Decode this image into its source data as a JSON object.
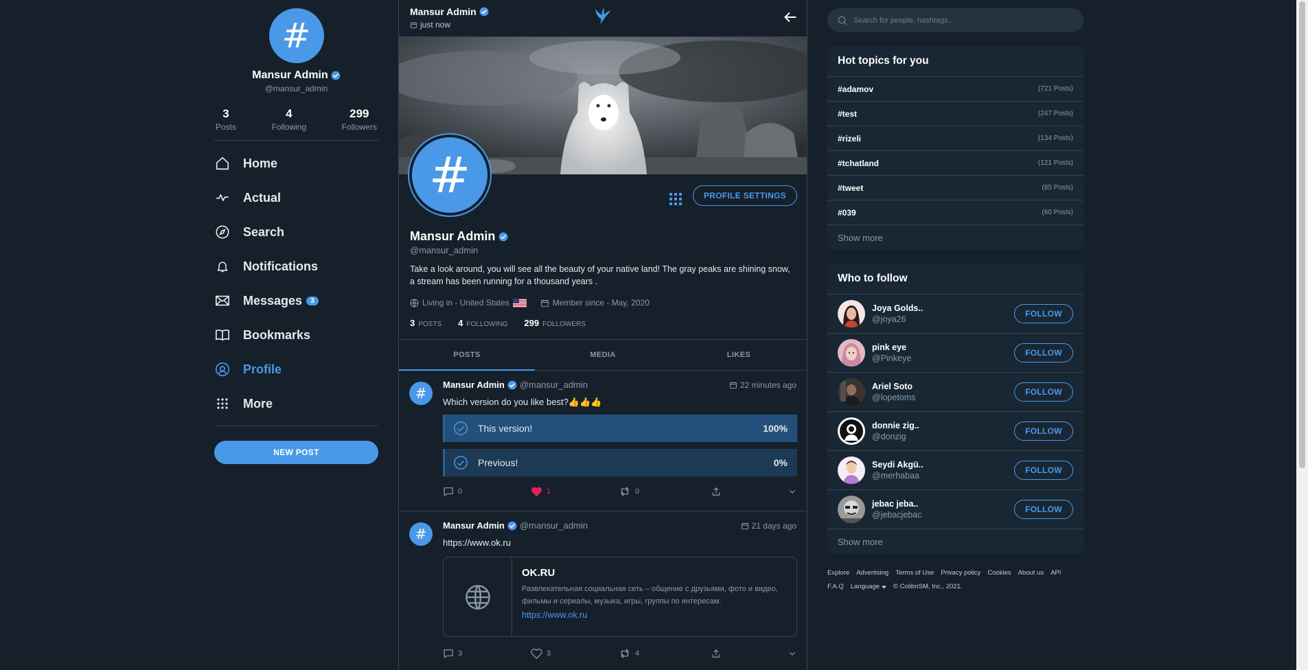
{
  "sidebar": {
    "profile": {
      "name": "Mansur Admin",
      "handle": "@mansur_admin"
    },
    "stats": [
      {
        "value": "3",
        "label": "Posts"
      },
      {
        "value": "4",
        "label": "Following"
      },
      {
        "value": "299",
        "label": "Followers"
      }
    ],
    "nav": [
      {
        "label": "Home",
        "icon": "home-icon"
      },
      {
        "label": "Actual",
        "icon": "activity-icon"
      },
      {
        "label": "Search",
        "icon": "compass-icon"
      },
      {
        "label": "Notifications",
        "icon": "bell-icon"
      },
      {
        "label": "Messages",
        "icon": "mail-icon",
        "badge": "3"
      },
      {
        "label": "Bookmarks",
        "icon": "book-icon"
      },
      {
        "label": "Profile",
        "icon": "at-icon",
        "active": true
      },
      {
        "label": "More",
        "icon": "grid-icon"
      }
    ],
    "new_post_label": "NEW POST"
  },
  "topbar": {
    "name": "Mansur Admin",
    "time": "just now"
  },
  "profile": {
    "name": "Mansur Admin",
    "handle": "@mansur_admin",
    "settings_label": "PROFILE SETTINGS",
    "bio": "Take a look around, you will see all the beauty of your native land! The gray peaks are shining snow, a stream has been running for a thousand years .",
    "location": "Living in - United States",
    "member_since": "Member since - May, 2020",
    "counts": [
      {
        "value": "3",
        "label": "POSTS"
      },
      {
        "value": "4",
        "label": "FOLLOWING"
      },
      {
        "value": "299",
        "label": "FOLLOWERS"
      }
    ]
  },
  "tabs": [
    {
      "label": "POSTS",
      "active": true
    },
    {
      "label": "MEDIA"
    },
    {
      "label": "LIKES"
    }
  ],
  "posts": [
    {
      "author": "Mansur Admin",
      "handle": "@mansur_admin",
      "time": "22 minutes ago",
      "text": "Which version do you like best?👍👍👍",
      "poll": [
        {
          "label": "This version!",
          "percent": "100%",
          "fraction": 1.0
        },
        {
          "label": "Previous!",
          "percent": "0%",
          "fraction": 0.0
        }
      ],
      "comments": "0",
      "likes": "1",
      "reposts": "0",
      "liked": true
    },
    {
      "author": "Mansur Admin",
      "handle": "@mansur_admin",
      "time": "21 days ago",
      "link": "https://www.ok.ru",
      "card": {
        "title": "OK.RU",
        "description": "Развлекательная социальная сеть – общение с друзьями, фото и видео, фильмы и сериалы, музыка, игры, группы по интересам.",
        "url": "https://www.ok.ru"
      },
      "comments": "3",
      "likes": "3",
      "reposts": "4",
      "liked": false
    }
  ],
  "right": {
    "search_placeholder": "Search for people, hashtags..",
    "topics_title": "Hot topics for you",
    "topics": [
      {
        "tag": "#adamov",
        "count": "(721 Posts)"
      },
      {
        "tag": "#test",
        "count": "(247 Posts)"
      },
      {
        "tag": "#rizeli",
        "count": "(134 Posts)"
      },
      {
        "tag": "#tchatland",
        "count": "(121 Posts)"
      },
      {
        "tag": "#tweet",
        "count": "(85 Posts)"
      },
      {
        "tag": "#039",
        "count": "(60 Posts)"
      }
    ],
    "show_more": "Show more",
    "follow_title": "Who to follow",
    "follow": [
      {
        "name": "Joya Golds..",
        "handle": "@joya26"
      },
      {
        "name": "pink eye",
        "handle": "@Pinkeye"
      },
      {
        "name": "Ariel Soto",
        "handle": "@lopetoms"
      },
      {
        "name": "donnie zig..",
        "handle": "@donzig"
      },
      {
        "name": "Seydi Akgü..",
        "handle": "@merhabaa"
      },
      {
        "name": "jebac jeba..",
        "handle": "@jebacjebac"
      }
    ],
    "follow_label": "FOLLOW",
    "footer_links": [
      "Explore",
      "Advertising",
      "Terms of Use",
      "Privacy policy",
      "Cookies",
      "About us",
      "API"
    ],
    "footer_faq": "F.A.Q",
    "footer_language": "Language",
    "footer_copyright": "© ColibriSM, Inc., 2021."
  },
  "colors": {
    "accent": "#4a99e9",
    "background": "#15202b",
    "panel": "#192734",
    "like": "#e0245e"
  }
}
